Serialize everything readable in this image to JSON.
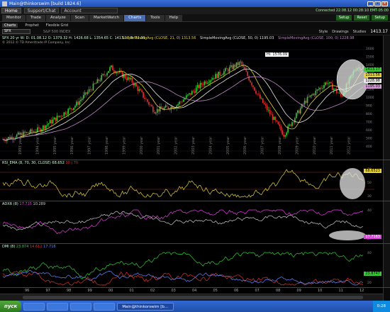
{
  "window": {
    "title": "Main@thinkorswim [build 1824.6]",
    "clock": "Connected 22.08.12 00:28:10 EMT-05:00"
  },
  "menubar": {
    "home": "Home",
    "support": "Support/Chat",
    "account_label": "Account"
  },
  "tabs": [
    "Monitor",
    "Trade",
    "Analyze",
    "Scan",
    "MarketWatch",
    "Charts",
    "Tools",
    "Help"
  ],
  "active_tab": "Charts",
  "tabbar_right": [
    "Setup",
    "Reset",
    "Setup"
  ],
  "subtabs": [
    "Charts",
    "Prophet",
    "Flexible Grid"
  ],
  "active_subtab": "Charts",
  "chart_header": {
    "symbol": "SPX",
    "symbol_desc": "S&P 500 INDEX",
    "style_btn": "Style",
    "drawings_btn": "Drawings",
    "studies_btn": "Studies",
    "price": "1413.17"
  },
  "price_panel": {
    "ohlc_label": "SPX 20 yr W: D: 01.08.12 O: 1379.32 H: 1426.68 L: 1354.65 C: 1413.17 R: 72.03",
    "sma21": "SimpleMovingAvg (CLOSE, 21, 0)  1313.56",
    "sma50": "SimpleMovingAvg (CLOSE, 50, 0)  1195.03",
    "sma100": "SimpleMovingAvg (CLOSE, 100, 0)  1228.98",
    "copyright": "© 2012 © TD Ameritrade IP Company, Inc.",
    "high_annot": "Hi: 1576.09",
    "badges": [
      {
        "text": "1413.17",
        "color": "#33cc33"
      },
      {
        "text": "1313.56",
        "color": "#e8d23a"
      },
      {
        "text": "1228.98",
        "color": "#e8e8e8"
      },
      {
        "text": "1195.03",
        "color": "#d99ad9"
      }
    ],
    "axis_ticks": [
      "1600",
      "1500",
      "1400",
      "1300",
      "1200",
      "1100",
      "1000",
      "900",
      "800",
      "700",
      "600",
      "500",
      "400"
    ],
    "year_labels": [
      "1993 year",
      "1994 year",
      "1995 year",
      "1996 year",
      "1997 year",
      "1998 year",
      "1999 year",
      "2000 year",
      "2001 year",
      "2002 year",
      "2003 year",
      "2004 year",
      "2005 year",
      "2006 year",
      "2007 year",
      "2008 year",
      "2009 year",
      "2010 year",
      "2011 year",
      "2012 year"
    ]
  },
  "rsi_panel": {
    "label": "RSI_EMA (8, 70, 30, CLOSE)  68.652",
    "value2": "30 | 70",
    "badge": "68.6523",
    "axis_ticks": [
      "70",
      "50",
      "30"
    ]
  },
  "adx_panel": {
    "label": "ADXR (8)",
    "v1": "17.715",
    "v2": "10.289",
    "badge": "17.7163",
    "axis_ticks": [
      "40",
      "20"
    ]
  },
  "dmi_panel": {
    "label": "DMI (8)",
    "v1": "23.874",
    "v2": "14.612",
    "v3": "17.716",
    "badge": "23.8747",
    "axis_ticks": [
      "40",
      "20"
    ]
  },
  "xaxis": [
    "96",
    "97",
    "98",
    "99",
    "00",
    "01",
    "02",
    "03",
    "04",
    "05",
    "06",
    "07",
    "08",
    "09",
    "10",
    "11",
    "12"
  ],
  "taskbar": {
    "start": "пуск",
    "items": [
      "",
      "",
      "",
      "",
      "Main@thinkorswim [b..."
    ],
    "time": "0:28"
  },
  "colors": {
    "candle_up": "#33cc33",
    "candle_down": "#e03030",
    "sma_yellow": "#e8d23a",
    "sma_white": "#e8e8e8",
    "sma_purple": "#c088c8",
    "rsi_line": "#e8d23a",
    "adx_magenta": "#e040e0",
    "adx_white": "#cccccc",
    "dmi_green": "#33cc33",
    "dmi_red": "#e03030",
    "dmi_blue": "#6688ff"
  }
}
